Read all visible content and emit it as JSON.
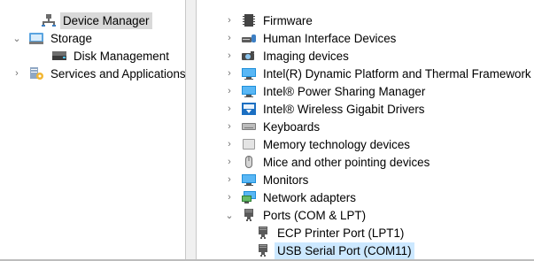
{
  "left_tree": [
    {
      "label": "Device Manager",
      "chevron": "",
      "icon": "device-manager-icon",
      "selected": true,
      "indent": 1
    },
    {
      "label": "Storage",
      "chevron": "⌄",
      "icon": "storage-icon",
      "selected": false,
      "indent": 0
    },
    {
      "label": "Disk Management",
      "chevron": "",
      "icon": "disk-management-icon",
      "selected": false,
      "indent": 1
    },
    {
      "label": "Services and Applications",
      "chevron": "›",
      "icon": "services-icon",
      "selected": false,
      "indent": 0
    }
  ],
  "right_tree": [
    {
      "label": "Firmware",
      "chevron": "›",
      "icon": "firmware-icon"
    },
    {
      "label": "Human Interface Devices",
      "chevron": "›",
      "icon": "hid-icon"
    },
    {
      "label": "Imaging devices",
      "chevron": "›",
      "icon": "imaging-icon"
    },
    {
      "label": "Intel(R) Dynamic Platform and Thermal Framework",
      "chevron": "›",
      "icon": "intel-folder-icon"
    },
    {
      "label": "Intel® Power Sharing Manager",
      "chevron": "›",
      "icon": "monitor-icon"
    },
    {
      "label": "Intel® Wireless Gigabit Drivers",
      "chevron": "›",
      "icon": "wireless-gigabit-icon"
    },
    {
      "label": "Keyboards",
      "chevron": "›",
      "icon": "keyboard-icon"
    },
    {
      "label": "Memory technology devices",
      "chevron": "›",
      "icon": "memory-icon"
    },
    {
      "label": "Mice and other pointing devices",
      "chevron": "›",
      "icon": "mouse-icon"
    },
    {
      "label": "Monitors",
      "chevron": "›",
      "icon": "monitor-icon"
    },
    {
      "label": "Network adapters",
      "chevron": "›",
      "icon": "network-icon"
    },
    {
      "label": "Ports (COM & LPT)",
      "chevron": "⌄",
      "icon": "port-icon"
    },
    {
      "label": "ECP Printer Port (LPT1)",
      "chevron": "",
      "icon": "port-icon",
      "child": true
    },
    {
      "label": "USB Serial Port (COM11)",
      "chevron": "",
      "icon": "port-icon",
      "child": true,
      "highlight": true
    }
  ],
  "colors": {
    "selection": "#d9d9d9",
    "highlight": "#cce8ff"
  }
}
